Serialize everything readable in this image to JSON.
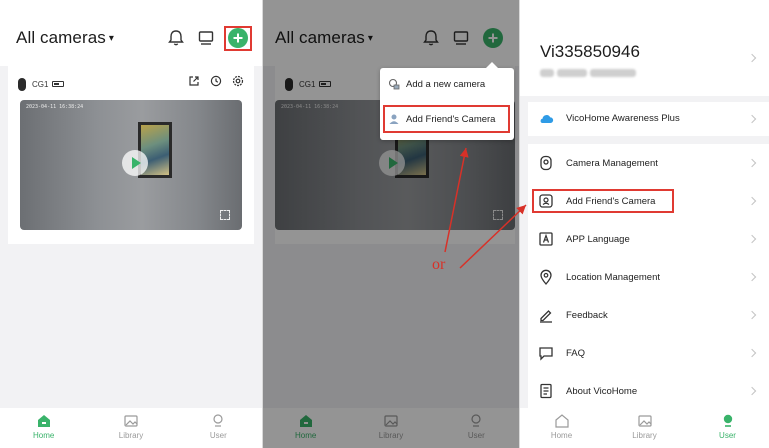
{
  "home": {
    "title": "All cameras",
    "camera": {
      "name": "CG1",
      "timestamp": "2023-04-11 16:38:24"
    },
    "nav": [
      {
        "label": "Home",
        "icon": "home-icon",
        "active": true
      },
      {
        "label": "Library",
        "icon": "library-icon",
        "active": false
      },
      {
        "label": "User",
        "icon": "user-icon",
        "active": false
      }
    ]
  },
  "popup": {
    "items": [
      {
        "label": "Add a new camera",
        "icon": "camera-icon"
      },
      {
        "label": "Add Friend's Camera",
        "icon": "friend-icon"
      }
    ]
  },
  "user": {
    "username": "Vi335850946",
    "plus_label": "VicoHome Awareness Plus",
    "menu": [
      {
        "label": "Camera Management",
        "icon": "camera-management-icon"
      },
      {
        "label": "Add Friend's Camera",
        "icon": "friend-camera-icon"
      },
      {
        "label": "APP Language",
        "icon": "language-icon"
      },
      {
        "label": "Location Management",
        "icon": "location-icon"
      },
      {
        "label": "Feedback",
        "icon": "feedback-icon"
      },
      {
        "label": "FAQ",
        "icon": "faq-icon"
      },
      {
        "label": "About VicoHome",
        "icon": "about-icon"
      }
    ],
    "nav": [
      {
        "label": "Home",
        "icon": "home-icon",
        "active": false
      },
      {
        "label": "Library",
        "icon": "library-icon",
        "active": false
      },
      {
        "label": "User",
        "icon": "user-icon",
        "active": true
      }
    ]
  },
  "annotation": {
    "or_text": "or"
  },
  "colors": {
    "accent": "#39b36a",
    "highlight": "#e03a32",
    "plus_icon": "#2f9be6"
  }
}
